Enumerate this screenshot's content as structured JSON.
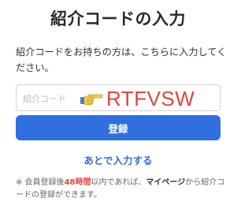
{
  "page": {
    "title": "紹介コードの入力",
    "description": "紹介コードをお持ちの方は、こちらに入力してください。"
  },
  "code_field": {
    "placeholder": "紹介コード",
    "pointer_icon": "pointing-hand-icon",
    "entered_value": "RTFVSW"
  },
  "actions": {
    "register_label": "登録",
    "later_label": "あとで入力する"
  },
  "note": {
    "part1": "※ 会員登録後",
    "hours": "48時間",
    "part2": "以内であれば、",
    "mypage": "マイページ",
    "part3": "から紹介コードの登録ができます。"
  },
  "colors": {
    "accent": "#2f6fe0",
    "code_highlight": "#e2463a",
    "hours_highlight": "#e2463a"
  }
}
